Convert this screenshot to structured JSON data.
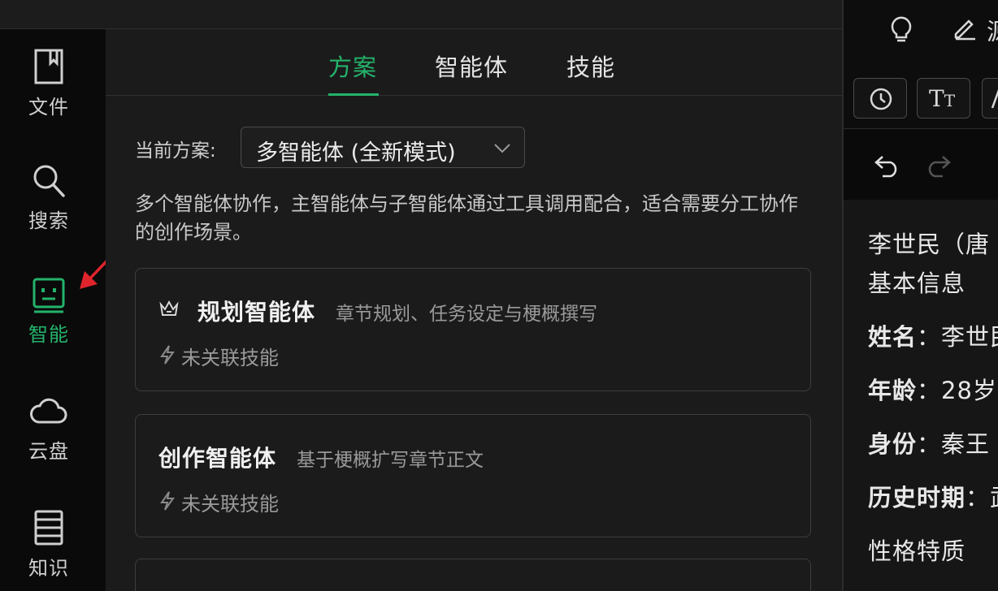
{
  "sidebar": {
    "items": [
      {
        "label": "文件",
        "icon": "bookmark-icon"
      },
      {
        "label": "搜索",
        "icon": "search-icon"
      },
      {
        "label": "智能",
        "icon": "robot-face-icon"
      },
      {
        "label": "云盘",
        "icon": "cloud-icon"
      },
      {
        "label": "知识",
        "icon": "list-icon"
      }
    ],
    "active": "智能"
  },
  "tabs": [
    {
      "label": "方案"
    },
    {
      "label": "智能体"
    },
    {
      "label": "技能"
    }
  ],
  "plan": {
    "label": "当前方案:",
    "selected": "多智能体 (全新模式)",
    "description": "多个智能体协作，主智能体与子智能体通过工具调用配合，适合需要分工协作的创作场景。"
  },
  "agents": [
    {
      "name": "规划智能体",
      "desc": "章节规划、任务设定与梗概撰写",
      "skill": "未关联技能",
      "icon": "crown-icon"
    },
    {
      "name": "创作智能体",
      "desc": "基于梗概扩写章节正文",
      "skill": "未关联技能"
    }
  ],
  "right_panel": {
    "top_icons": [
      "lightbulb-icon",
      "pencil-icon"
    ],
    "top_partial": "源",
    "buttons": [
      "history-icon",
      "font-size-icon",
      "format-icon"
    ],
    "lines": [
      {
        "label": "李世民（唐",
        "value": ""
      },
      {
        "label": "基本信息",
        "value": ""
      },
      {
        "label": "姓名",
        "value": "：李世民"
      },
      {
        "label": "年龄",
        "value": "：28岁"
      },
      {
        "label": "身份",
        "value": "：秦王"
      },
      {
        "label": "历史时期",
        "value": "：武"
      },
      {
        "label": "性格特质",
        "value": ""
      }
    ]
  },
  "colors": {
    "accent": "#24b36b",
    "arrow": "#e0242c"
  }
}
